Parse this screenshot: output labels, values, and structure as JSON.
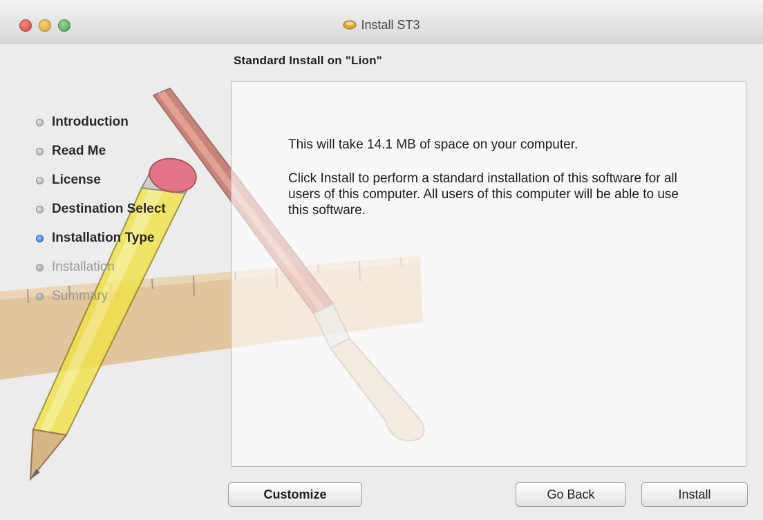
{
  "window": {
    "title": "Install ST3"
  },
  "heading": "Standard Install on \"Lion\"",
  "steps": [
    {
      "label": "Introduction",
      "state": "done"
    },
    {
      "label": "Read Me",
      "state": "done"
    },
    {
      "label": "License",
      "state": "done"
    },
    {
      "label": "Destination Select",
      "state": "done"
    },
    {
      "label": "Installation Type",
      "state": "current"
    },
    {
      "label": "Installation",
      "state": "pending"
    },
    {
      "label": "Summary",
      "state": "pending"
    }
  ],
  "content": {
    "space_text": "This will take 14.1 MB of space on your computer.",
    "description": "Click Install to perform a standard installation of this software for all users of this computer. All users of this computer will be able to use this software."
  },
  "buttons": {
    "customize": "Customize",
    "go_back": "Go Back",
    "install": "Install"
  },
  "colors": {
    "current_step_bullet": "#2b6fd1",
    "window_background": "#ececec"
  },
  "icons": {
    "app": "package-icon",
    "background_art": "pencil-ruler-brush-artwork"
  }
}
